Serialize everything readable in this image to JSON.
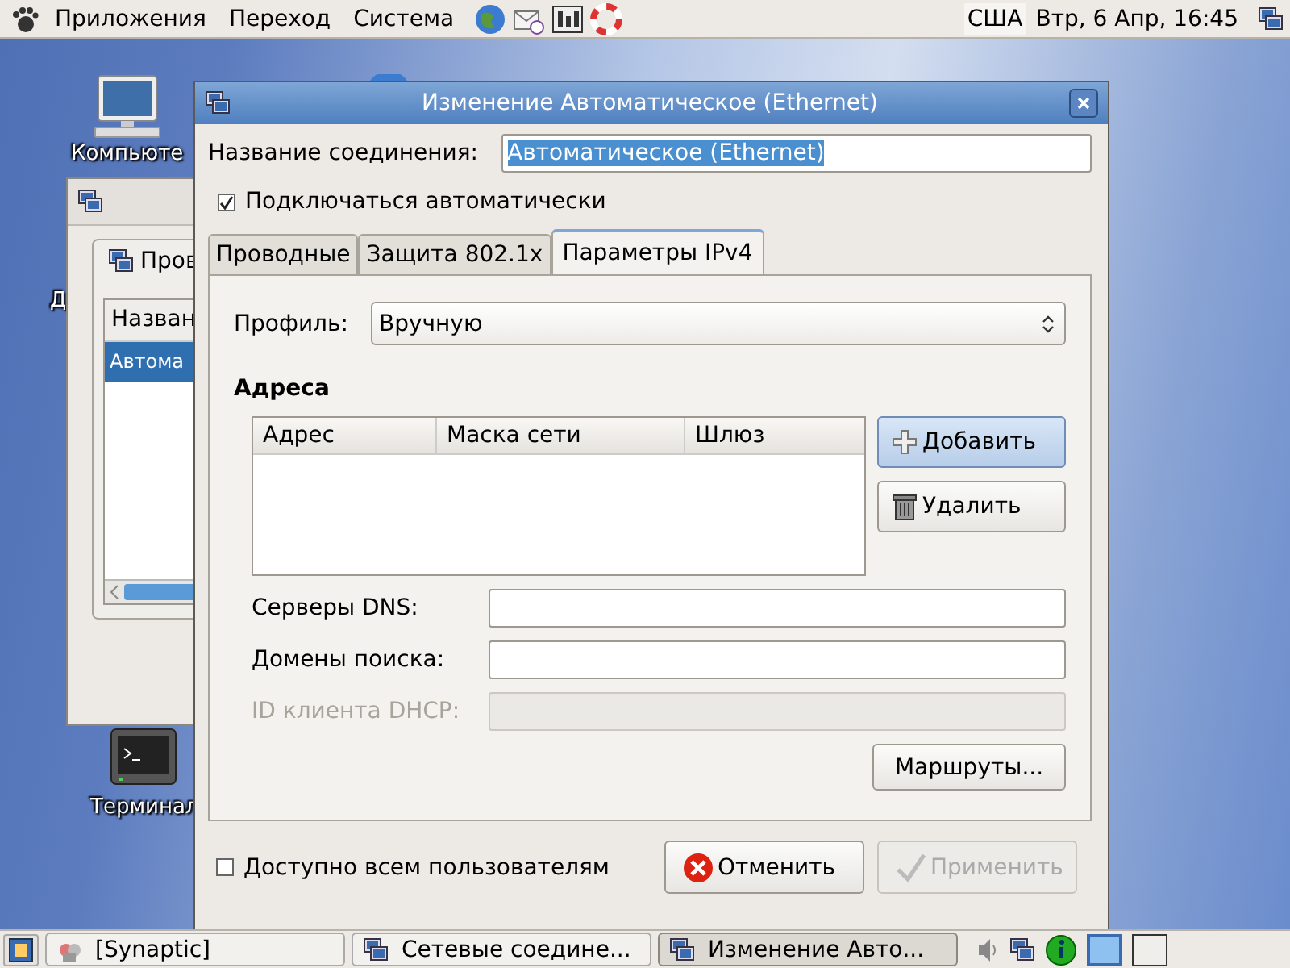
{
  "top_panel": {
    "menus": [
      "Приложения",
      "Переход",
      "Система"
    ],
    "keyboard_layout": "США",
    "clock": "Втр,  6 Апр, 16:45"
  },
  "desktop_icons": [
    {
      "label": "Компьюте",
      "kind": "computer"
    },
    {
      "label": "Д",
      "kind": "none"
    },
    {
      "label": "Терминал",
      "kind": "terminal"
    }
  ],
  "background_window": {
    "tab": "Пров",
    "column": "Назван",
    "rows": [
      {
        "text": "Автома",
        "selected": true
      }
    ]
  },
  "dialog": {
    "title": "Изменение Автоматическое (Ethernet)",
    "name_label": "Название соединения:",
    "name_value": "Автоматическое (Ethernet)",
    "auto_connect": {
      "label": "Подключаться автоматически",
      "checked": true
    },
    "tabs": [
      {
        "label": "Проводные",
        "selected": false
      },
      {
        "label": "Защита 802.1x",
        "selected": false
      },
      {
        "label": "Параметры IPv4",
        "selected": true
      }
    ],
    "profile_label": "Профиль:",
    "profile_value": "Вручную",
    "addresses_heading": "Адреса",
    "address_columns": [
      "Адрес",
      "Маска сети",
      "Шлюз"
    ],
    "add_button": "Добавить",
    "delete_button": "Удалить",
    "fields": [
      {
        "label": "Серверы DNS:",
        "disabled": false
      },
      {
        "label": "Домены поиска:",
        "disabled": false
      },
      {
        "label": "ID клиента DHCP:",
        "disabled": true
      }
    ],
    "routes_button": "Маршруты...",
    "all_users": {
      "label": "Доступно всем пользователям",
      "checked": false
    },
    "cancel_button": "Отменить",
    "apply_button": {
      "label": "Применить",
      "disabled": true
    }
  },
  "taskbar": {
    "tasks": [
      {
        "label": "[Synaptic]",
        "selected": false,
        "kind": "synaptic"
      },
      {
        "label": "Сетевые соедине...",
        "selected": false,
        "kind": "network"
      },
      {
        "label": "Изменение Авто...",
        "selected": true,
        "kind": "network"
      }
    ],
    "workspaces": [
      {
        "selected": true
      },
      {
        "selected": false
      }
    ]
  }
}
